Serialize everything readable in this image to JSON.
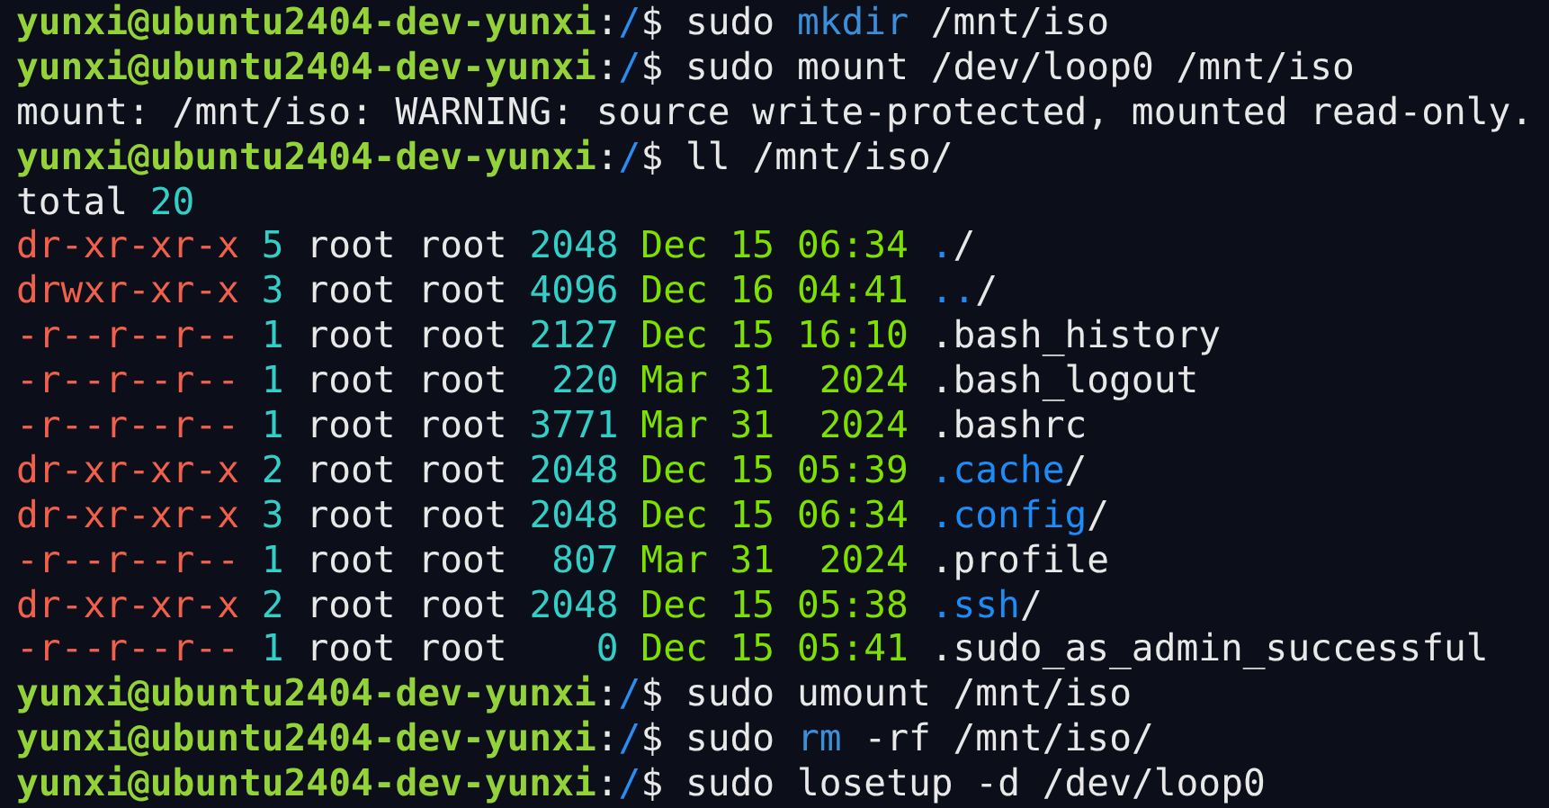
{
  "terminal": {
    "lines": [
      {
        "kind": "prompt",
        "user_host": "yunxi@ubuntu2404-dev-yunxi",
        "colon": ":",
        "path": "/",
        "symbol": "$",
        "command": [
          {
            "kind": "plain",
            "text": "sudo"
          },
          {
            "kind": "builtin",
            "text": "mkdir"
          },
          {
            "kind": "plain",
            "text": "/mnt/iso"
          }
        ]
      },
      {
        "kind": "prompt",
        "user_host": "yunxi@ubuntu2404-dev-yunxi",
        "colon": ":",
        "path": "/",
        "symbol": "$",
        "command": [
          {
            "kind": "plain",
            "text": "sudo"
          },
          {
            "kind": "plain",
            "text": "mount"
          },
          {
            "kind": "plain",
            "text": "/dev/loop0"
          },
          {
            "kind": "plain",
            "text": "/mnt/iso"
          }
        ]
      },
      {
        "kind": "output",
        "text": "mount: /mnt/iso: WARNING: source write-protected, mounted read-only."
      },
      {
        "kind": "prompt",
        "user_host": "yunxi@ubuntu2404-dev-yunxi",
        "colon": ":",
        "path": "/",
        "symbol": "$",
        "command": [
          {
            "kind": "plain",
            "text": "ll"
          },
          {
            "kind": "plain",
            "text": "/mnt/iso/"
          }
        ]
      },
      {
        "kind": "total",
        "label": "total",
        "count": "20"
      },
      {
        "kind": "entry",
        "perms": "dr-xr-xr-x",
        "links": "5",
        "owner": "root",
        "group": "root",
        "size": "2048",
        "month": "Dec",
        "day": "15",
        "time": "06:34",
        "name": ".",
        "is_dir": true,
        "suffix": "/"
      },
      {
        "kind": "entry",
        "perms": "drwxr-xr-x",
        "links": "3",
        "owner": "root",
        "group": "root",
        "size": "4096",
        "month": "Dec",
        "day": "16",
        "time": "04:41",
        "name": "..",
        "is_dir": true,
        "suffix": "/"
      },
      {
        "kind": "entry",
        "perms": "-r--r--r--",
        "links": "1",
        "owner": "root",
        "group": "root",
        "size": "2127",
        "month": "Dec",
        "day": "15",
        "time": "16:10",
        "name": ".bash_history",
        "is_dir": false
      },
      {
        "kind": "entry",
        "perms": "-r--r--r--",
        "links": "1",
        "owner": "root",
        "group": "root",
        "size": "220",
        "month": "Mar",
        "day": "31",
        "time": "2024",
        "name": ".bash_logout",
        "is_dir": false
      },
      {
        "kind": "entry",
        "perms": "-r--r--r--",
        "links": "1",
        "owner": "root",
        "group": "root",
        "size": "3771",
        "month": "Mar",
        "day": "31",
        "time": "2024",
        "name": ".bashrc",
        "is_dir": false
      },
      {
        "kind": "entry",
        "perms": "dr-xr-xr-x",
        "links": "2",
        "owner": "root",
        "group": "root",
        "size": "2048",
        "month": "Dec",
        "day": "15",
        "time": "05:39",
        "name": ".cache",
        "is_dir": true,
        "suffix": "/"
      },
      {
        "kind": "entry",
        "perms": "dr-xr-xr-x",
        "links": "3",
        "owner": "root",
        "group": "root",
        "size": "2048",
        "month": "Dec",
        "day": "15",
        "time": "06:34",
        "name": ".config",
        "is_dir": true,
        "suffix": "/"
      },
      {
        "kind": "entry",
        "perms": "-r--r--r--",
        "links": "1",
        "owner": "root",
        "group": "root",
        "size": "807",
        "month": "Mar",
        "day": "31",
        "time": "2024",
        "name": ".profile",
        "is_dir": false
      },
      {
        "kind": "entry",
        "perms": "dr-xr-xr-x",
        "links": "2",
        "owner": "root",
        "group": "root",
        "size": "2048",
        "month": "Dec",
        "day": "15",
        "time": "05:38",
        "name": ".ssh",
        "is_dir": true,
        "suffix": "/"
      },
      {
        "kind": "entry",
        "perms": "-r--r--r--",
        "links": "1",
        "owner": "root",
        "group": "root",
        "size": "0",
        "month": "Dec",
        "day": "15",
        "time": "05:41",
        "name": ".sudo_as_admin_successful",
        "is_dir": false
      },
      {
        "kind": "prompt",
        "user_host": "yunxi@ubuntu2404-dev-yunxi",
        "colon": ":",
        "path": "/",
        "symbol": "$",
        "command": [
          {
            "kind": "plain",
            "text": "sudo"
          },
          {
            "kind": "plain",
            "text": "umount"
          },
          {
            "kind": "plain",
            "text": "/mnt/iso"
          }
        ]
      },
      {
        "kind": "prompt",
        "user_host": "yunxi@ubuntu2404-dev-yunxi",
        "colon": ":",
        "path": "/",
        "symbol": "$",
        "command": [
          {
            "kind": "plain",
            "text": "sudo"
          },
          {
            "kind": "builtin",
            "text": "rm"
          },
          {
            "kind": "plain",
            "text": "-rf"
          },
          {
            "kind": "plain",
            "text": "/mnt/iso/"
          }
        ]
      },
      {
        "kind": "prompt",
        "user_host": "yunxi@ubuntu2404-dev-yunxi",
        "colon": ":",
        "path": "/",
        "symbol": "$",
        "command": [
          {
            "kind": "plain",
            "text": "sudo"
          },
          {
            "kind": "plain",
            "text": "losetup"
          },
          {
            "kind": "plain",
            "text": "-d"
          },
          {
            "kind": "plain",
            "text": "/dev/loop0"
          }
        ]
      }
    ]
  }
}
